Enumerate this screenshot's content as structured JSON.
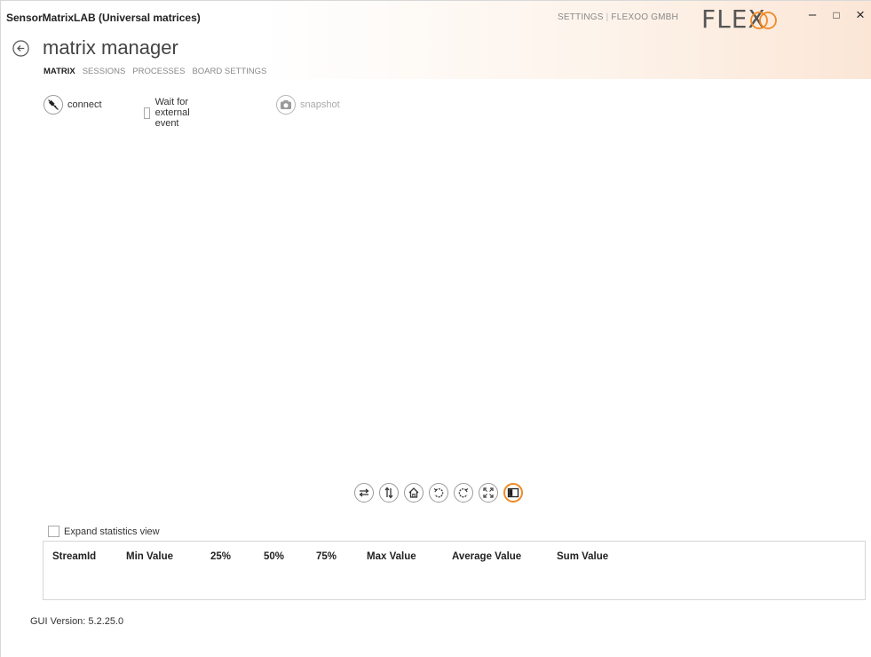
{
  "window": {
    "app_title": "SensorMatrixLAB (Universal matrices)",
    "top_links": [
      "SETTINGS",
      "FLEXOO GMBH"
    ],
    "logo_text": "FLEX",
    "controls": {
      "minimize": "–",
      "maximize": "□",
      "close": "×"
    }
  },
  "header": {
    "page_title": "matrix manager",
    "nav_tabs": [
      {
        "label": "MATRIX",
        "active": true
      },
      {
        "label": "SESSIONS",
        "active": false
      },
      {
        "label": "PROCESSES",
        "active": false
      },
      {
        "label": "BOARD SETTINGS",
        "active": false
      }
    ]
  },
  "toolbar": {
    "connect_label": "connect",
    "external_event_label": "Wait for external event",
    "external_event_checked": false,
    "snapshot_label": "snapshot",
    "snapshot_enabled": false
  },
  "plot_tools": [
    {
      "name": "swap-axes-icon",
      "active": false
    },
    {
      "name": "flip-vertical-icon",
      "active": false
    },
    {
      "name": "home-icon",
      "active": false
    },
    {
      "name": "rotate-left-icon",
      "active": false
    },
    {
      "name": "rotate-right-icon",
      "active": false
    },
    {
      "name": "fit-to-screen-icon",
      "active": false
    },
    {
      "name": "panel-toggle-icon",
      "active": true
    }
  ],
  "statistics": {
    "expand_label": "Expand statistics view",
    "expand_checked": false,
    "columns": [
      "StreamId",
      "Min Value",
      "25%",
      "50%",
      "75%",
      "Max Value",
      "Average Value",
      "Sum Value"
    ],
    "rows": []
  },
  "footer": {
    "gui_version": "GUI Version: 5.2.25.0"
  },
  "colors": {
    "accent": "#f08a24",
    "header_gradient_end": "#fbe6d6",
    "text": "#333333",
    "muted": "#888888"
  }
}
